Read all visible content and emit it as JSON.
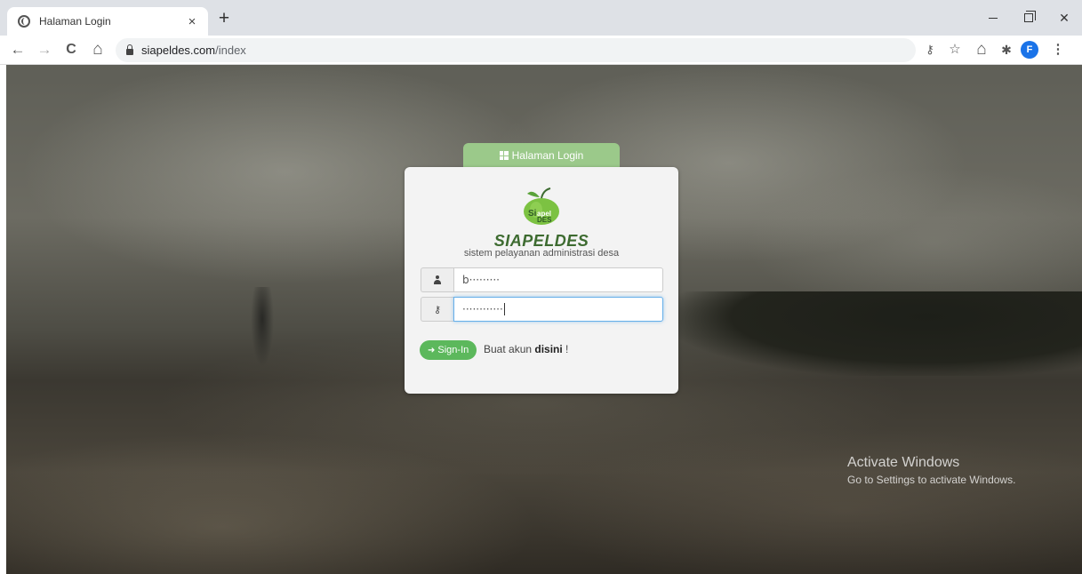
{
  "browser": {
    "tab_title": "Halaman Login",
    "tab_close": "×",
    "new_tab": "+",
    "url_host": "siapeldes.com",
    "url_path": "/index",
    "avatar_letter": "F",
    "nav": {
      "back": "←",
      "forward": "→",
      "reload": "C",
      "home": "⌂"
    },
    "toolbar_icons": [
      "key-icon",
      "star-icon",
      "home-icon",
      "extensions-icon",
      "profile-avatar",
      "menu-icon"
    ]
  },
  "login": {
    "tab_label": "Halaman Login",
    "brand": "SIAPELDES",
    "tagline": "sistem pelayanan administrasi desa",
    "logo_text": "SiapelDES",
    "username_value": "b·········",
    "password_value": "············",
    "signin_label": "Sign-In",
    "register_prefix": "Buat akun ",
    "register_link": "disini",
    "register_suffix": " !"
  },
  "windows": {
    "activate_title": "Activate Windows",
    "activate_sub": "Go to Settings to activate Windows."
  },
  "colors": {
    "accent_green": "#9bc98a",
    "button_green": "#5cb85c",
    "brand_green": "#3d6b30",
    "chrome_bg": "#dee1e6"
  }
}
